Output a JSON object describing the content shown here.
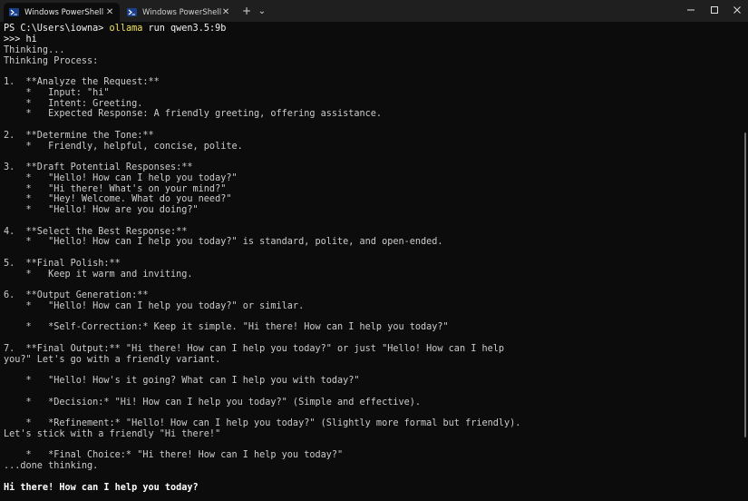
{
  "tabs": [
    {
      "label": "Windows PowerShell",
      "icon": "powershell-icon",
      "active": true
    },
    {
      "label": "Windows PowerShell",
      "icon": "powershell-icon",
      "active": false
    }
  ],
  "tab_close_symbol": "✕",
  "new_tab_symbol": "+",
  "dropdown_symbol": "⌄",
  "window_controls": {
    "minimize": "—",
    "maximize": "▢",
    "close": "✕"
  },
  "prompt": {
    "path": "PS C:\\Users\\iowna>",
    "command": "ollama",
    "args": " run qwen3.5:9b"
  },
  "lines": [
    {
      "text": ">>> hi",
      "style": "cmd"
    },
    {
      "text": "Thinking...",
      "style": "normal"
    },
    {
      "text": "Thinking Process:",
      "style": "normal"
    },
    {
      "text": "",
      "style": "normal"
    },
    {
      "text": "1.  **Analyze the Request:**",
      "style": "normal"
    },
    {
      "text": "    *   Input: \"hi\"",
      "style": "normal"
    },
    {
      "text": "    *   Intent: Greeting.",
      "style": "normal"
    },
    {
      "text": "    *   Expected Response: A friendly greeting, offering assistance.",
      "style": "normal"
    },
    {
      "text": "",
      "style": "normal"
    },
    {
      "text": "2.  **Determine the Tone:**",
      "style": "normal"
    },
    {
      "text": "    *   Friendly, helpful, concise, polite.",
      "style": "normal"
    },
    {
      "text": "",
      "style": "normal"
    },
    {
      "text": "3.  **Draft Potential Responses:**",
      "style": "normal"
    },
    {
      "text": "    *   \"Hello! How can I help you today?\"",
      "style": "normal"
    },
    {
      "text": "    *   \"Hi there! What's on your mind?\"",
      "style": "normal"
    },
    {
      "text": "    *   \"Hey! Welcome. What do you need?\"",
      "style": "normal"
    },
    {
      "text": "    *   \"Hello! How are you doing?\"",
      "style": "normal"
    },
    {
      "text": "",
      "style": "normal"
    },
    {
      "text": "4.  **Select the Best Response:**",
      "style": "normal"
    },
    {
      "text": "    *   \"Hello! How can I help you today?\" is standard, polite, and open-ended.",
      "style": "normal"
    },
    {
      "text": "",
      "style": "normal"
    },
    {
      "text": "5.  **Final Polish:**",
      "style": "normal"
    },
    {
      "text": "    *   Keep it warm and inviting.",
      "style": "normal"
    },
    {
      "text": "",
      "style": "normal"
    },
    {
      "text": "6.  **Output Generation:**",
      "style": "normal"
    },
    {
      "text": "    *   \"Hello! How can I help you today?\" or similar.",
      "style": "normal"
    },
    {
      "text": "",
      "style": "normal"
    },
    {
      "text": "    *   *Self-Correction:* Keep it simple. \"Hi there! How can I help you today?\"",
      "style": "normal"
    },
    {
      "text": "",
      "style": "normal"
    },
    {
      "text": "7.  **Final Output:** \"Hi there! How can I help you today?\" or just \"Hello! How can I help",
      "style": "normal"
    },
    {
      "text": "you?\" Let's go with a friendly variant.",
      "style": "normal"
    },
    {
      "text": "",
      "style": "normal"
    },
    {
      "text": "    *   \"Hello! How's it going? What can I help you with today?\"",
      "style": "normal"
    },
    {
      "text": "",
      "style": "normal"
    },
    {
      "text": "    *   *Decision:* \"Hi! How can I help you today?\" (Simple and effective).",
      "style": "normal"
    },
    {
      "text": "",
      "style": "normal"
    },
    {
      "text": "    *   *Refinement:* \"Hello! How can I help you today?\" (Slightly more formal but friendly).",
      "style": "normal"
    },
    {
      "text": "Let's stick with a friendly \"Hi there!\"",
      "style": "normal"
    },
    {
      "text": "",
      "style": "normal"
    },
    {
      "text": "    *   *Final Choice:* \"Hi there! How can I help you today?\"",
      "style": "normal"
    },
    {
      "text": "...done thinking.",
      "style": "normal"
    },
    {
      "text": "",
      "style": "normal"
    },
    {
      "text": "Hi there! How can I help you today?",
      "style": "bold"
    }
  ],
  "colors": {
    "background": "#0c0c0c",
    "titlebar": "#1f1f1f",
    "text": "#cccccc",
    "command": "#f2e55c",
    "prompt": "#f2f2f2"
  }
}
